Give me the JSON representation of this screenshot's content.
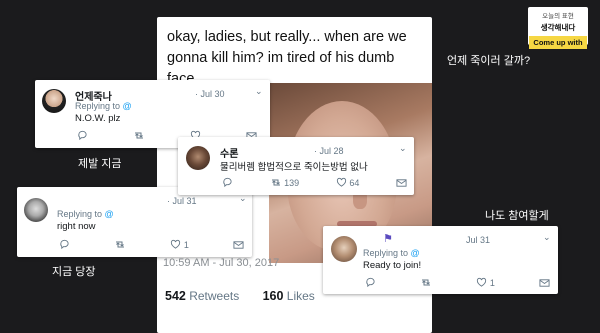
{
  "badge": {
    "line1": "오늘의 표현",
    "line2": "생각해내다",
    "line3": "Come up with"
  },
  "main_tweet": {
    "text": "okay, ladies, but really... when are we gonna kill him? im tired of his dumb face.",
    "date": "10:59 AM - Jul 30, 2017",
    "retweets_count": "542",
    "retweets_label": "Retweets",
    "likes_count": "160",
    "likes_label": "Likes"
  },
  "captions": {
    "right_top": "언제 죽이러 갈까?",
    "left_1": "제발 지금",
    "right_middle": "나도 참여할게",
    "left_2": "지금 당장"
  },
  "tweets": [
    {
      "name": "언제죽나",
      "date": "· Jul 30",
      "replying": "Replying to",
      "at": "@",
      "body": "N.O.W. plz",
      "reply_count": "",
      "rt_count": "",
      "like_count": ""
    },
    {
      "name": "수론",
      "date": "· Jul 28",
      "replying": "",
      "at": "",
      "body": "물리버렘 합법적으로 죽이는방법 없나",
      "reply_count": "",
      "rt_count": "139",
      "like_count": "64"
    },
    {
      "name": "",
      "date": "· Jul 31",
      "replying": "Replying to",
      "at": "@",
      "body": "right now",
      "reply_count": "",
      "rt_count": "",
      "like_count": "1"
    },
    {
      "name": "",
      "date": "Jul 31",
      "replying": "Replying to",
      "at": "@",
      "body": "Ready to join!",
      "reply_count": "",
      "rt_count": "",
      "like_count": "1"
    }
  ],
  "colors": {
    "background": "#1b1b1d",
    "link_blue": "#1da1f2",
    "badge_yellow": "#f6d743"
  }
}
